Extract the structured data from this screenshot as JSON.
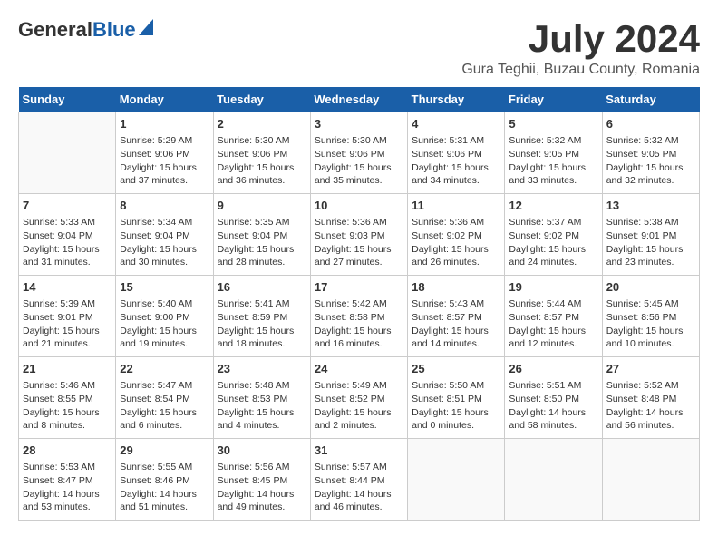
{
  "header": {
    "logo_general": "General",
    "logo_blue": "Blue",
    "month_title": "July 2024",
    "location": "Gura Teghii, Buzau County, Romania"
  },
  "days_of_week": [
    "Sunday",
    "Monday",
    "Tuesday",
    "Wednesday",
    "Thursday",
    "Friday",
    "Saturday"
  ],
  "weeks": [
    [
      {
        "day": "",
        "info": ""
      },
      {
        "day": "1",
        "info": "Sunrise: 5:29 AM\nSunset: 9:06 PM\nDaylight: 15 hours\nand 37 minutes."
      },
      {
        "day": "2",
        "info": "Sunrise: 5:30 AM\nSunset: 9:06 PM\nDaylight: 15 hours\nand 36 minutes."
      },
      {
        "day": "3",
        "info": "Sunrise: 5:30 AM\nSunset: 9:06 PM\nDaylight: 15 hours\nand 35 minutes."
      },
      {
        "day": "4",
        "info": "Sunrise: 5:31 AM\nSunset: 9:06 PM\nDaylight: 15 hours\nand 34 minutes."
      },
      {
        "day": "5",
        "info": "Sunrise: 5:32 AM\nSunset: 9:05 PM\nDaylight: 15 hours\nand 33 minutes."
      },
      {
        "day": "6",
        "info": "Sunrise: 5:32 AM\nSunset: 9:05 PM\nDaylight: 15 hours\nand 32 minutes."
      }
    ],
    [
      {
        "day": "7",
        "info": "Sunrise: 5:33 AM\nSunset: 9:04 PM\nDaylight: 15 hours\nand 31 minutes."
      },
      {
        "day": "8",
        "info": "Sunrise: 5:34 AM\nSunset: 9:04 PM\nDaylight: 15 hours\nand 30 minutes."
      },
      {
        "day": "9",
        "info": "Sunrise: 5:35 AM\nSunset: 9:04 PM\nDaylight: 15 hours\nand 28 minutes."
      },
      {
        "day": "10",
        "info": "Sunrise: 5:36 AM\nSunset: 9:03 PM\nDaylight: 15 hours\nand 27 minutes."
      },
      {
        "day": "11",
        "info": "Sunrise: 5:36 AM\nSunset: 9:02 PM\nDaylight: 15 hours\nand 26 minutes."
      },
      {
        "day": "12",
        "info": "Sunrise: 5:37 AM\nSunset: 9:02 PM\nDaylight: 15 hours\nand 24 minutes."
      },
      {
        "day": "13",
        "info": "Sunrise: 5:38 AM\nSunset: 9:01 PM\nDaylight: 15 hours\nand 23 minutes."
      }
    ],
    [
      {
        "day": "14",
        "info": "Sunrise: 5:39 AM\nSunset: 9:01 PM\nDaylight: 15 hours\nand 21 minutes."
      },
      {
        "day": "15",
        "info": "Sunrise: 5:40 AM\nSunset: 9:00 PM\nDaylight: 15 hours\nand 19 minutes."
      },
      {
        "day": "16",
        "info": "Sunrise: 5:41 AM\nSunset: 8:59 PM\nDaylight: 15 hours\nand 18 minutes."
      },
      {
        "day": "17",
        "info": "Sunrise: 5:42 AM\nSunset: 8:58 PM\nDaylight: 15 hours\nand 16 minutes."
      },
      {
        "day": "18",
        "info": "Sunrise: 5:43 AM\nSunset: 8:57 PM\nDaylight: 15 hours\nand 14 minutes."
      },
      {
        "day": "19",
        "info": "Sunrise: 5:44 AM\nSunset: 8:57 PM\nDaylight: 15 hours\nand 12 minutes."
      },
      {
        "day": "20",
        "info": "Sunrise: 5:45 AM\nSunset: 8:56 PM\nDaylight: 15 hours\nand 10 minutes."
      }
    ],
    [
      {
        "day": "21",
        "info": "Sunrise: 5:46 AM\nSunset: 8:55 PM\nDaylight: 15 hours\nand 8 minutes."
      },
      {
        "day": "22",
        "info": "Sunrise: 5:47 AM\nSunset: 8:54 PM\nDaylight: 15 hours\nand 6 minutes."
      },
      {
        "day": "23",
        "info": "Sunrise: 5:48 AM\nSunset: 8:53 PM\nDaylight: 15 hours\nand 4 minutes."
      },
      {
        "day": "24",
        "info": "Sunrise: 5:49 AM\nSunset: 8:52 PM\nDaylight: 15 hours\nand 2 minutes."
      },
      {
        "day": "25",
        "info": "Sunrise: 5:50 AM\nSunset: 8:51 PM\nDaylight: 15 hours\nand 0 minutes."
      },
      {
        "day": "26",
        "info": "Sunrise: 5:51 AM\nSunset: 8:50 PM\nDaylight: 14 hours\nand 58 minutes."
      },
      {
        "day": "27",
        "info": "Sunrise: 5:52 AM\nSunset: 8:48 PM\nDaylight: 14 hours\nand 56 minutes."
      }
    ],
    [
      {
        "day": "28",
        "info": "Sunrise: 5:53 AM\nSunset: 8:47 PM\nDaylight: 14 hours\nand 53 minutes."
      },
      {
        "day": "29",
        "info": "Sunrise: 5:55 AM\nSunset: 8:46 PM\nDaylight: 14 hours\nand 51 minutes."
      },
      {
        "day": "30",
        "info": "Sunrise: 5:56 AM\nSunset: 8:45 PM\nDaylight: 14 hours\nand 49 minutes."
      },
      {
        "day": "31",
        "info": "Sunrise: 5:57 AM\nSunset: 8:44 PM\nDaylight: 14 hours\nand 46 minutes."
      },
      {
        "day": "",
        "info": ""
      },
      {
        "day": "",
        "info": ""
      },
      {
        "day": "",
        "info": ""
      }
    ]
  ]
}
